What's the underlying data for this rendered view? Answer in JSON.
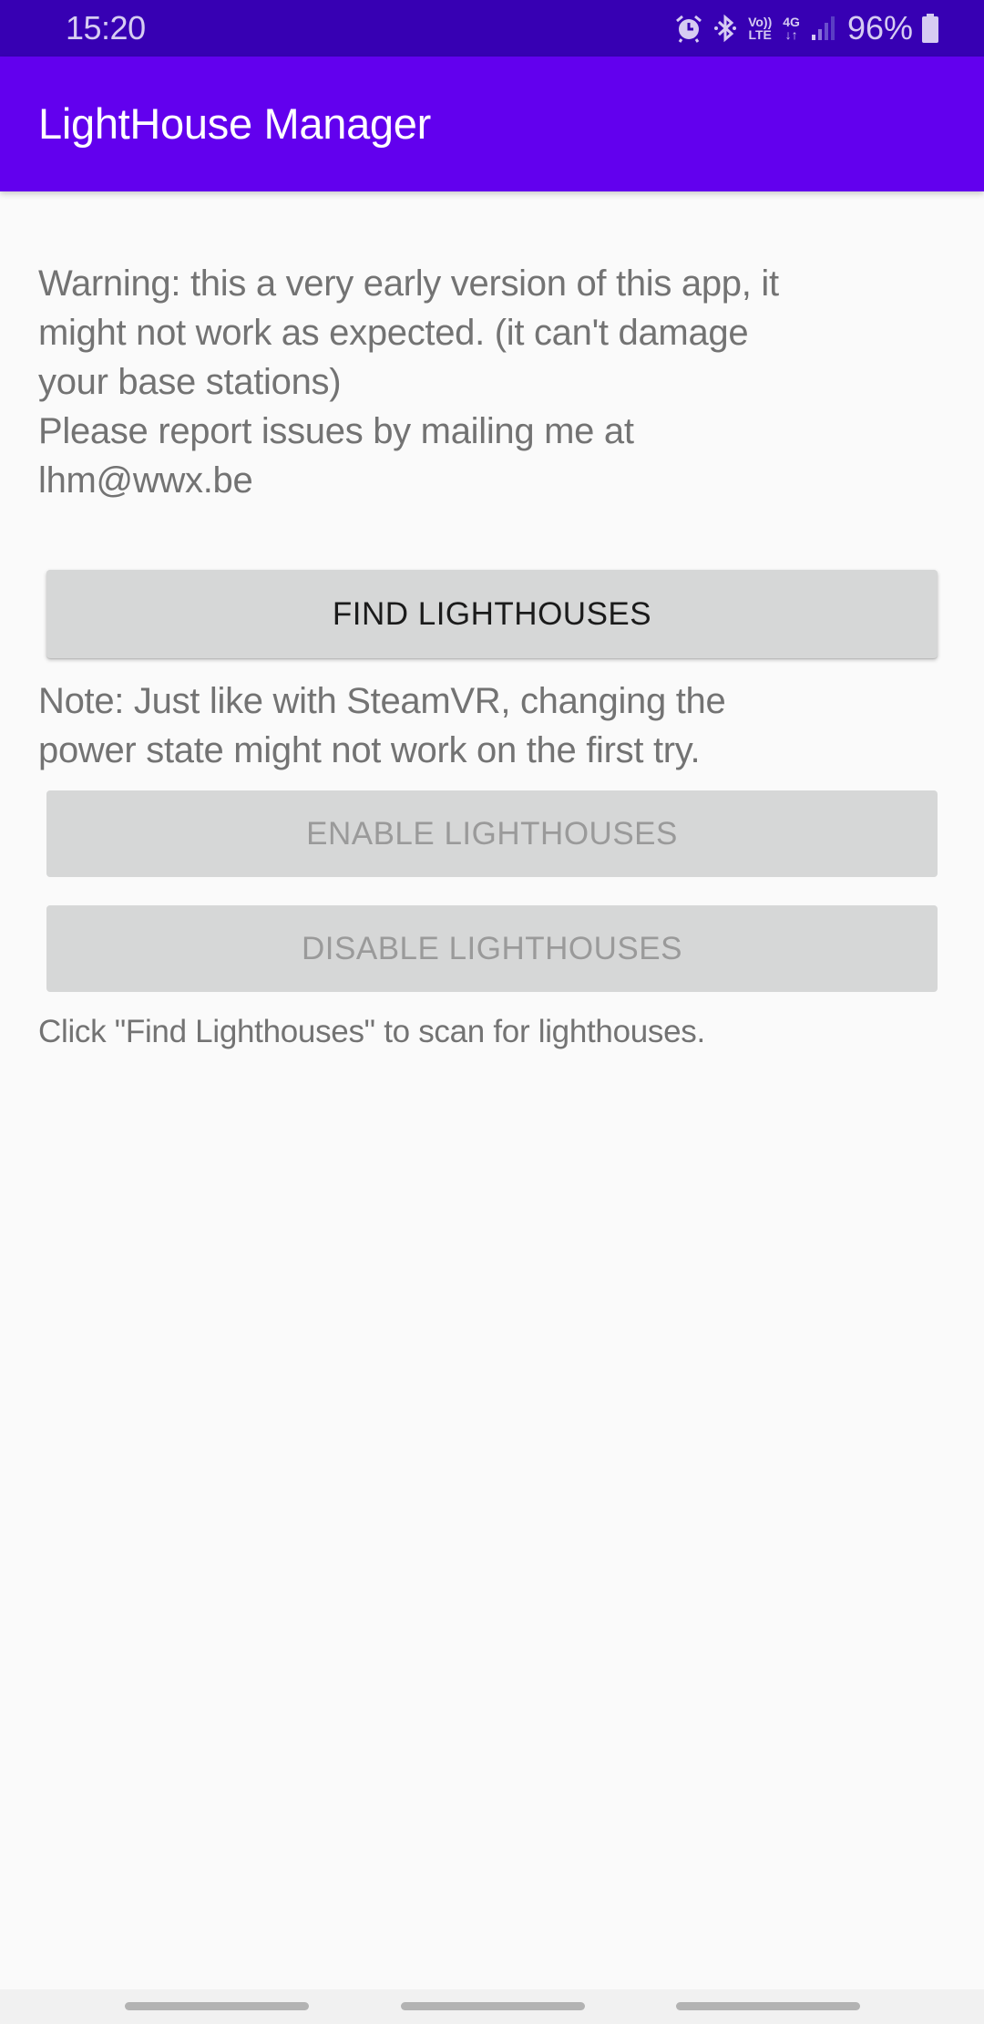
{
  "status_bar": {
    "time": "15:20",
    "icons": [
      "alarm-icon",
      "bluetooth-icon",
      "volte-icon",
      "4g-data-icon",
      "signal-icon",
      "battery-icon"
    ],
    "volte_top": "Vo))",
    "volte_bottom": "LTE",
    "network_label": "4G",
    "network_arrows": "↓↑",
    "battery_percent": "96%",
    "battery_level": 0.96
  },
  "app_bar": {
    "title": "LightHouse Manager",
    "color": "#6200ee",
    "status_color": "#3700b3"
  },
  "main": {
    "warning_lines": [
      "Warning: this a very early version of this app, it",
      "might not work as expected. (it can't damage",
      "your base stations)",
      "Please report issues by mailing me at",
      "lhm@wwx.be"
    ],
    "find_button": {
      "label": "Find Lighthouses",
      "enabled": true
    },
    "note_lines": [
      "Note: Just like with SteamVR, changing the",
      "power state might not work on the first try."
    ],
    "enable_button": {
      "label": "Enable Lighthouses",
      "enabled": false
    },
    "disable_button": {
      "label": "Disable Lighthouses",
      "enabled": false
    },
    "status_message": "Click \"Find Lighthouses\" to scan for lighthouses."
  },
  "nav_bar": {
    "items": [
      "recents-gesture",
      "home-gesture",
      "back-gesture"
    ]
  }
}
